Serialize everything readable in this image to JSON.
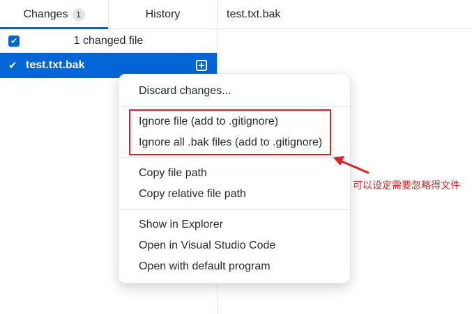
{
  "tabs": {
    "changes_label": "Changes",
    "changes_badge": "1",
    "history_label": "History"
  },
  "changes": {
    "header_label": "1 changed file",
    "files": [
      {
        "name": "test.txt.bak",
        "checked": true
      }
    ]
  },
  "right_header": {
    "title": "test.txt.bak"
  },
  "context_menu": {
    "groups": [
      [
        "Discard changes..."
      ],
      [
        "Ignore file (add to .gitignore)",
        "Ignore all .bak files (add to .gitignore)"
      ],
      [
        "Copy file path",
        "Copy relative file path"
      ],
      [
        "Show in Explorer",
        "Open in Visual Studio Code",
        "Open with default program"
      ]
    ]
  },
  "annotation": {
    "text": "可以设定需要忽略得文件",
    "color": "#e02020"
  },
  "colors": {
    "accent": "#0366d6",
    "annotation_red": "#e02020"
  }
}
